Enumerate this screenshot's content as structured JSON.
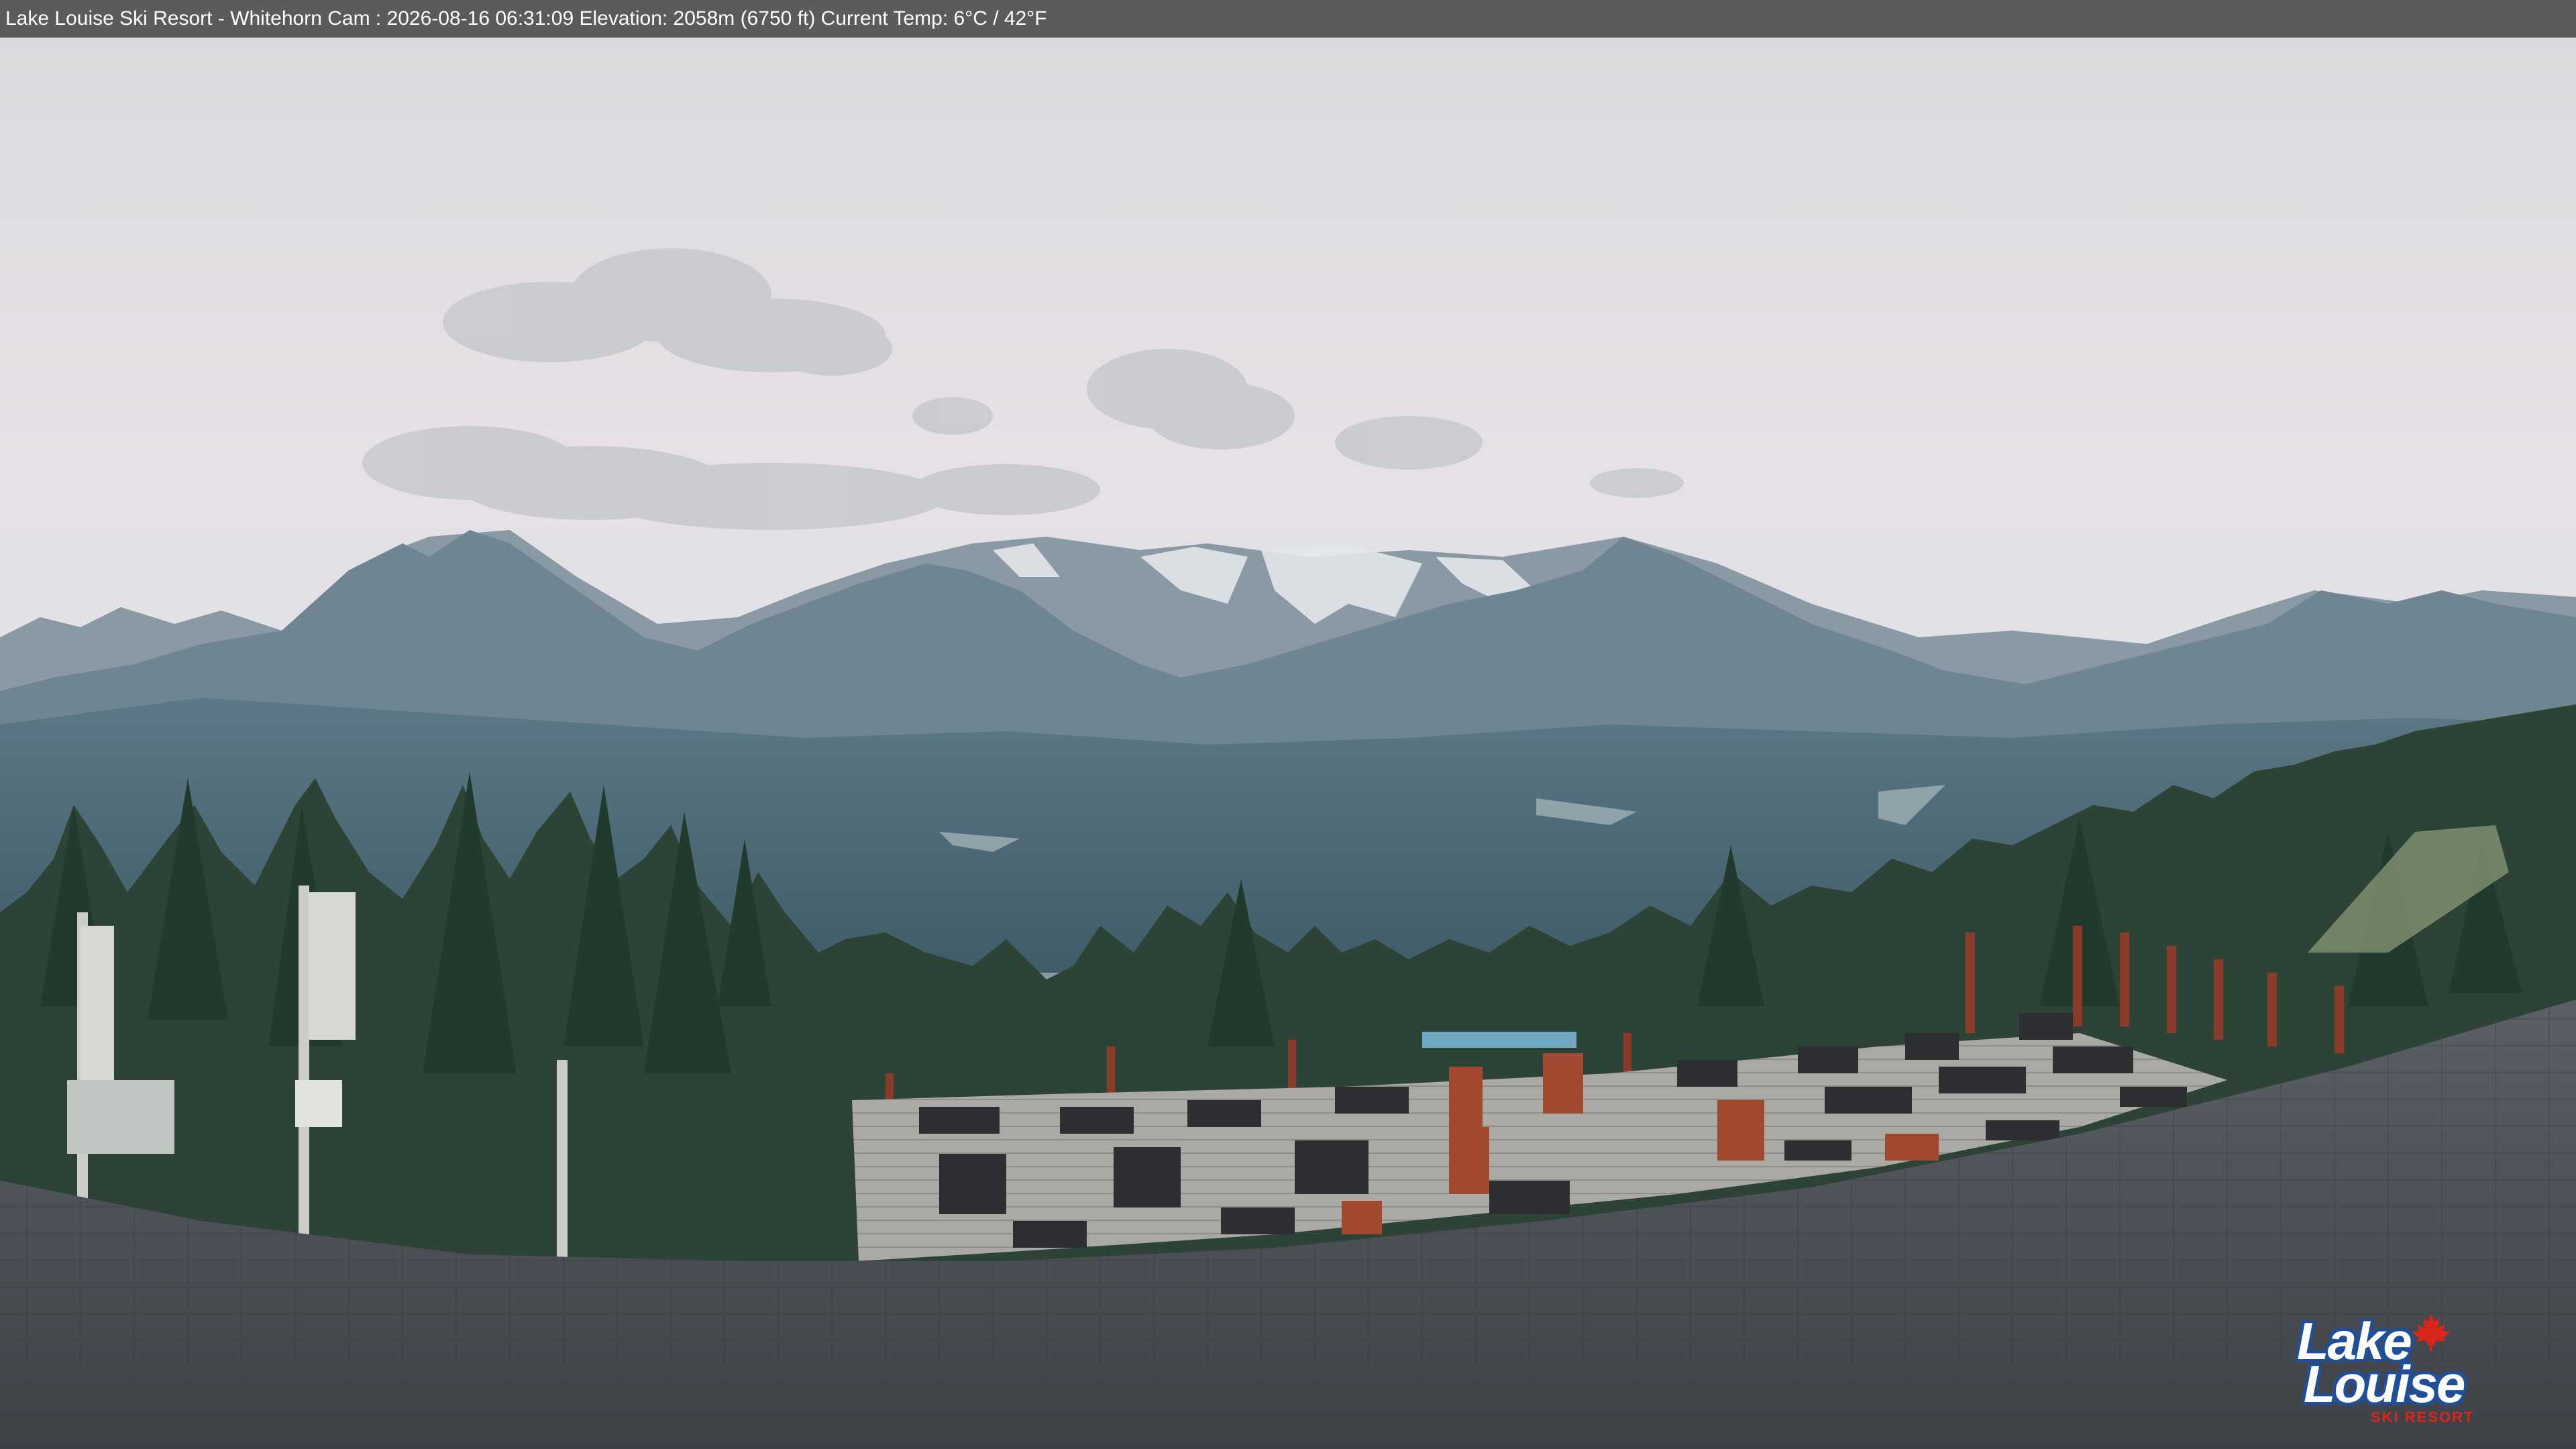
{
  "overlay": {
    "caption": "Lake Louise Ski Resort - Whitehorn Cam : 2026-08-16 06:31:09  Elevation: 2058m (6750 ft) Current Temp: 6°C / 42°F"
  },
  "logo": {
    "line1": "Lake",
    "line2": "Louise",
    "tagline": "SKI RESORT",
    "icon": "maple-leaf-icon",
    "text_color": "#ffffff",
    "outline_color": "#1d4f9c",
    "accent_color": "#d9261c"
  },
  "colors": {
    "sky_top": "#dcdde0",
    "sky_bottom": "#e9e2e6",
    "mountains": "#6f8591",
    "forest": "#2c4234",
    "deck": "#a9a8a3",
    "roof": "#4d5157"
  }
}
